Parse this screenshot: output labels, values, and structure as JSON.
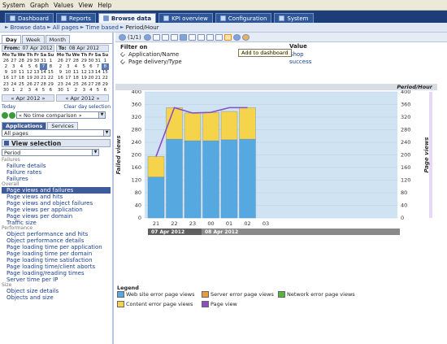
{
  "menu": [
    "System",
    "Graph",
    "Values",
    "View",
    "Help"
  ],
  "tabs": [
    {
      "label": "Dashboard",
      "active": false
    },
    {
      "label": "Reports",
      "active": false
    },
    {
      "label": "Browse data",
      "active": true
    },
    {
      "label": "KPI overview",
      "active": false
    },
    {
      "label": "Configuration",
      "active": false
    },
    {
      "label": "System",
      "active": false
    }
  ],
  "breadcrumb": [
    "Browse data",
    "All pages",
    "Time based",
    "Period/Hour"
  ],
  "period_tabs": [
    "Day",
    "Week",
    "Month"
  ],
  "calendar_from": {
    "label": "From:",
    "date": "07 Apr 2012",
    "days": [
      "Mo",
      "Tu",
      "We",
      "Th",
      "Fr",
      "Sa",
      "Su"
    ],
    "rows": [
      [
        "26",
        "27",
        "28",
        "29",
        "30",
        "31",
        "1"
      ],
      [
        "2",
        "3",
        "4",
        "5",
        "6",
        "7",
        "8"
      ],
      [
        "9",
        "10",
        "11",
        "12",
        "13",
        "14",
        "15"
      ],
      [
        "16",
        "17",
        "18",
        "19",
        "20",
        "21",
        "22"
      ],
      [
        "23",
        "24",
        "25",
        "26",
        "27",
        "28",
        "29"
      ],
      [
        "30",
        "1",
        "2",
        "3",
        "4",
        "5",
        "6"
      ]
    ],
    "nav": "« Apr 2012 »"
  },
  "calendar_to": {
    "label": "To:",
    "date": "08 Apr 2012",
    "days": [
      "Mo",
      "Tu",
      "We",
      "Th",
      "Fr",
      "Sa",
      "Su"
    ],
    "rows": [
      [
        "26",
        "27",
        "28",
        "29",
        "30",
        "31",
        "1"
      ],
      [
        "2",
        "3",
        "4",
        "5",
        "6",
        "7",
        "8"
      ],
      [
        "9",
        "10",
        "11",
        "12",
        "13",
        "14",
        "15"
      ],
      [
        "16",
        "17",
        "18",
        "19",
        "20",
        "21",
        "22"
      ],
      [
        "23",
        "24",
        "25",
        "26",
        "27",
        "28",
        "29"
      ],
      [
        "30",
        "1",
        "2",
        "3",
        "4",
        "5",
        "6"
      ]
    ],
    "nav": "« Apr 2012 »"
  },
  "today_link": "Today",
  "clear_link": "Clear day selection",
  "time_comparison": "« No time comparison »",
  "app_tabs": [
    "Applications",
    "Services"
  ],
  "page_select": "All pages",
  "view_selection": {
    "title": "View selection",
    "select": "Period",
    "groups": [
      {
        "name": "Failures",
        "items": [
          "Failure details",
          "Failure rates",
          "Failures"
        ]
      },
      {
        "name": "Overall",
        "items": [
          "Page views and failures",
          "Page views and hits",
          "Page views and object failures",
          "Page views per application",
          "Page views per domain",
          "Traffic size"
        ]
      },
      {
        "name": "Performance",
        "items": [
          "Object performance and hits",
          "Object performance details",
          "Page loading time per application",
          "Page loading time per domain",
          "Page loading time satisfaction",
          "Page loading time/client aborts",
          "Page loading/reading times",
          "Server time per IP"
        ]
      },
      {
        "name": "Size",
        "items": [
          "Object size details",
          "Objects and size"
        ]
      }
    ],
    "selected": "Page views and failures"
  },
  "toolbar": {
    "pager": "(1/1)",
    "tooltip": "Add to dashboard"
  },
  "filter": {
    "col1": "Filter on",
    "col2": "Value",
    "rows": [
      {
        "name": "Application/Name",
        "value": "Shop"
      },
      {
        "name": "Page delivery/Type",
        "value": "success"
      }
    ]
  },
  "chart_header": "Period/Hour",
  "chart_data": {
    "type": "bar",
    "categories": [
      "21",
      "22",
      "23",
      "00",
      "01",
      "02",
      "03"
    ],
    "series": [
      {
        "name": "Web site error page views",
        "color": "#55a8e0",
        "values": [
          130,
          250,
          245,
          245,
          248,
          250,
          0
        ]
      },
      {
        "name": "Content error page views",
        "color": "#f5d34a",
        "values": [
          65,
          100,
          88,
          90,
          90,
          100,
          0
        ]
      }
    ],
    "line": {
      "name": "Page view",
      "color": "#8a4fc7",
      "values": [
        null,
        350,
        333,
        335,
        350,
        350,
        null
      ]
    },
    "left_axis_label": "Failed views",
    "right_axis_label": "Page views",
    "ylim": [
      0,
      400
    ],
    "yticks": [
      0,
      40,
      80,
      120,
      160,
      200,
      240,
      280,
      320,
      360,
      400
    ],
    "date_labels": [
      "07 Apr 2012",
      "08 Apr 2012"
    ]
  },
  "legend": {
    "title": "Legend",
    "items": [
      {
        "label": "Web site error page views",
        "color": "#55a8e0"
      },
      {
        "label": "Server error page views",
        "color": "#ef9a3a"
      },
      {
        "label": "Network error page views",
        "color": "#55b43e"
      },
      {
        "label": "Content error page views",
        "color": "#f5d34a"
      },
      {
        "label": "Page view",
        "color": "#8a4fc7"
      }
    ]
  }
}
